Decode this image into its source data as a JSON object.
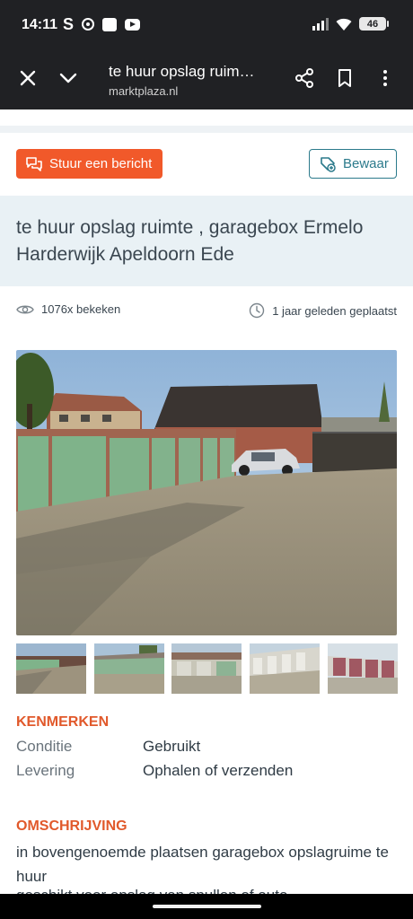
{
  "status": {
    "time": "14:11",
    "app_s": "S",
    "battery": "46"
  },
  "toolbar": {
    "title": "te huur opslag ruim…",
    "url": "marktplaza.nl"
  },
  "actions": {
    "message_label": "Stuur een bericht",
    "save_label": "Bewaar"
  },
  "listing": {
    "title": "te huur opslag ruimte , garagebox Ermelo Harderwijk Apeldoorn Ede",
    "views": "1076x bekeken",
    "posted": "1 jaar geleden geplaatst"
  },
  "specs": {
    "heading": "KENMERKEN",
    "rows": [
      {
        "key": "Conditie",
        "value": "Gebruikt"
      },
      {
        "key": "Levering",
        "value": "Ophalen of verzenden"
      }
    ]
  },
  "description": {
    "heading": "OMSCHRIJVING",
    "text": "in bovengenoemde plaatsen garagebox opslagruime te huur",
    "faded": "geschikt voor opslag van spullen of auto"
  },
  "colors": {
    "accent": "#f1592a",
    "teal": "#2b7a8b",
    "heading": "#e1592b",
    "title_bg": "#e9f1f5"
  },
  "icons": [
    "close-icon",
    "chevron-down-icon",
    "share-icon",
    "bookmark-icon",
    "more-vert-icon",
    "chat-icon",
    "save-heart-icon",
    "eye-icon",
    "clock-icon"
  ]
}
